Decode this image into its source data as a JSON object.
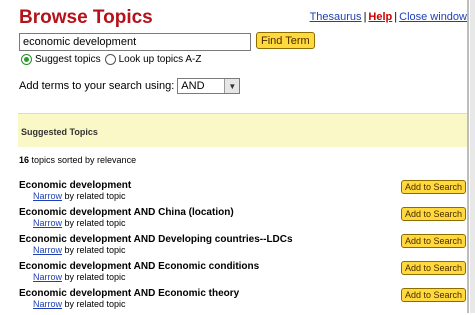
{
  "header": {
    "title": "Browse Topics",
    "links": {
      "thesaurus": "Thesaurus",
      "sep": "|",
      "help": "Help",
      "close": "Close window"
    }
  },
  "search": {
    "value": "economic development",
    "find_label": "Find Term"
  },
  "mode": {
    "suggest_label": "Suggest topics",
    "lookup_label": "Look up topics A-Z",
    "selected": "suggest"
  },
  "combine": {
    "label": "Add terms to your search using:",
    "selected": "AND"
  },
  "suggested": {
    "heading": "Suggested Topics"
  },
  "summary": {
    "count": "16",
    "text": " topics sorted by relevance"
  },
  "results": [
    {
      "title": "Economic development",
      "narrow": "Narrow",
      "by": " by related topic",
      "add": "Add to Search"
    },
    {
      "title": "Economic development AND China (location)",
      "narrow": "Narrow",
      "by": " by related topic",
      "add": "Add to Search"
    },
    {
      "title": "Economic development AND Developing countries--LDCs",
      "narrow": "Narrow",
      "by": " by related topic",
      "add": "Add to Search"
    },
    {
      "title": "Economic development AND Economic conditions",
      "narrow": "Narrow",
      "by": " by related topic",
      "add": "Add to Search"
    },
    {
      "title": "Economic development AND Economic theory",
      "narrow": "Narrow",
      "by": " by related topic",
      "add": "Add to Search"
    }
  ]
}
